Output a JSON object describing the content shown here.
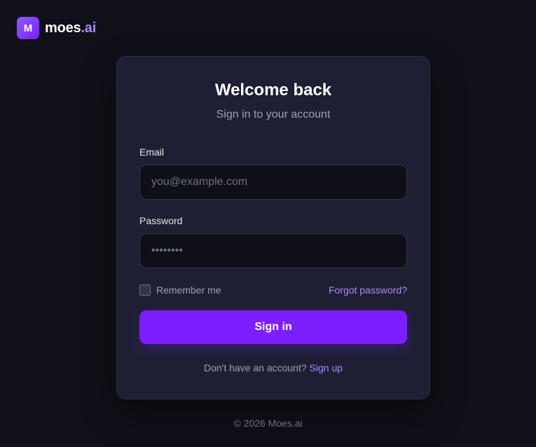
{
  "brand": {
    "mark": "M",
    "name": "moes",
    "suffix": ".ai",
    "accent_color": "#a78bfa",
    "button_color": "#7c1fff"
  },
  "card": {
    "title": "Welcome back",
    "subtitle": "Sign in to your account"
  },
  "form": {
    "email_label": "Email",
    "email_placeholder": "you@example.com",
    "email_value": "",
    "password_label": "Password",
    "password_placeholder": "••••••••",
    "password_value": "",
    "remember_label": "Remember me",
    "remember_checked": false,
    "forgot_label": "Forgot password?",
    "submit_label": "Sign in"
  },
  "signup": {
    "prompt": "Don't have an account?",
    "link_label": "Sign up"
  },
  "footer": {
    "copyright": "© 2026 Moes.ai"
  }
}
